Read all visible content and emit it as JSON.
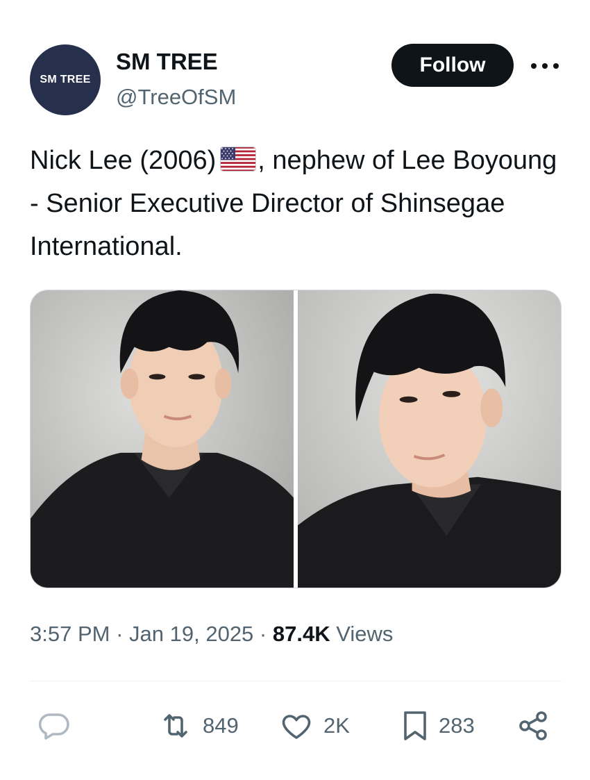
{
  "account": {
    "avatar_text": "SM TREE",
    "display_name": "SM TREE",
    "handle": "@TreeOfSM"
  },
  "header": {
    "follow_label": "Follow"
  },
  "tweet": {
    "text_part1": "Nick Lee (2006)",
    "flag_icon": "us-flag-icon",
    "text_part2": ", nephew of Lee Boyoung - Senior Executive Director of Shinsegae International."
  },
  "media": {
    "count": 2,
    "icons": [
      "portrait-photo-1",
      "portrait-photo-2"
    ]
  },
  "meta": {
    "time": "3:57 PM",
    "separator": "·",
    "date": "Jan 19, 2025",
    "views_count": "87.4K",
    "views_label": "Views"
  },
  "actions": {
    "reply_icon": "reply-icon",
    "repost_count": "849",
    "like_count": "2K",
    "bookmark_count": "283",
    "share_icon": "share-icon"
  },
  "colors": {
    "text_primary": "#0f1419",
    "text_secondary": "#536471",
    "avatar_bg": "#262f4c",
    "border": "#cfd9de"
  }
}
